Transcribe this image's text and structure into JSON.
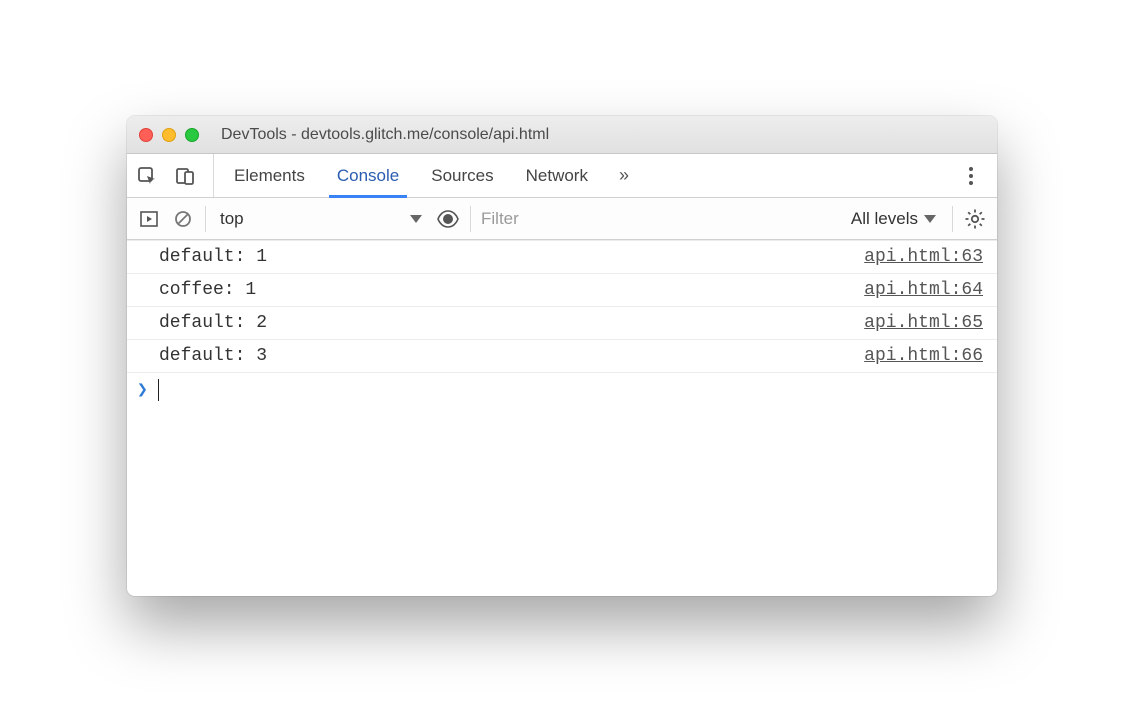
{
  "window": {
    "title": "DevTools - devtools.glitch.me/console/api.html"
  },
  "tabs": {
    "items": [
      {
        "label": "Elements"
      },
      {
        "label": "Console"
      },
      {
        "label": "Sources"
      },
      {
        "label": "Network"
      }
    ],
    "activeIndex": 1,
    "overflow_glyph": "»"
  },
  "filterbar": {
    "context": "top",
    "filter_placeholder": "Filter",
    "levels_label": "All levels"
  },
  "logs": [
    {
      "text": "default: 1",
      "src": "api.html:63"
    },
    {
      "text": "coffee: 1",
      "src": "api.html:64"
    },
    {
      "text": "default: 2",
      "src": "api.html:65"
    },
    {
      "text": "default: 3",
      "src": "api.html:66"
    }
  ],
  "prompt": {
    "glyph": "❯"
  }
}
